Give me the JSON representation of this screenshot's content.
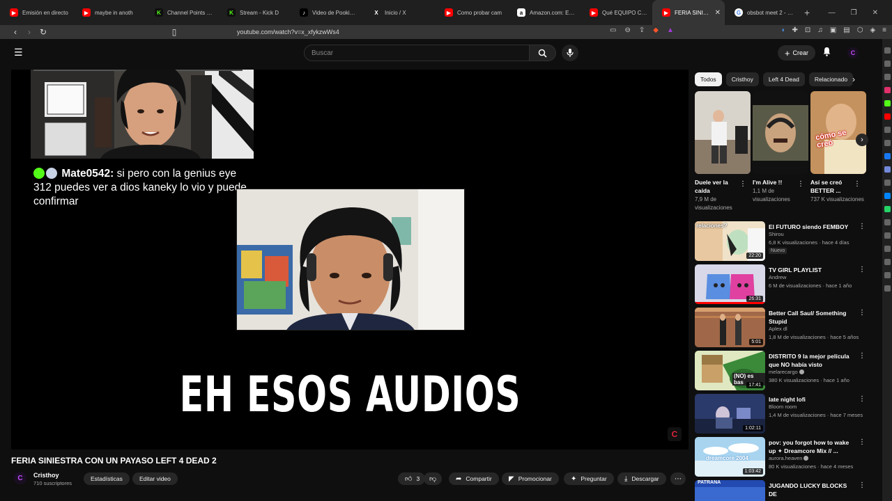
{
  "browser": {
    "tabs": [
      {
        "title": "Emisión en directo",
        "icon": "youtube-icon",
        "kind": "yt"
      },
      {
        "title": "maybe in anoth",
        "icon": "youtube-icon",
        "kind": "yt"
      },
      {
        "title": "Channel Points - Ki",
        "icon": "kick-icon",
        "kind": "kick"
      },
      {
        "title": "Stream - Kick D",
        "icon": "kick-icon",
        "kind": "kick"
      },
      {
        "title": "Video de Pookie be",
        "icon": "tiktok-icon",
        "kind": "tt"
      },
      {
        "title": "Inicio / X",
        "icon": "x-icon",
        "kind": "xx"
      },
      {
        "title": "Como probar cam",
        "icon": "youtube-icon",
        "kind": "yt"
      },
      {
        "title": "Amazon.com: EMB",
        "icon": "amazon-icon",
        "kind": "amz"
      },
      {
        "title": "Qué EQUIPO COMI",
        "icon": "youtube-icon",
        "kind": "yt"
      },
      {
        "title": "FERIA SINIESTR",
        "icon": "youtube-icon",
        "kind": "yt",
        "active": true
      },
      {
        "title": "obsbot meet 2 - Bu",
        "icon": "google-icon",
        "kind": "g"
      }
    ],
    "url": "youtube.com/watch?v=x_xfykzwWs4"
  },
  "header": {
    "search_placeholder": "Buscar",
    "create_label": "Crear",
    "avatar_letter": "C"
  },
  "player": {
    "chat": {
      "user": "Mate0542:",
      "message": "si pero con la genius eye 312 puedes ver a dios kaneky lo vio y puede confirmar"
    },
    "caption": "EH ESOS AUDIOS",
    "watermark_letter": "C"
  },
  "video": {
    "title": "FERIA SINIESTRA CON UN PAYASO LEFT 4 DEAD 2",
    "channel": "Cristhoy",
    "subscribers": "710 suscriptores",
    "avatar_letter": "C",
    "buttons": {
      "stats": "Estadísticas",
      "edit": "Editar video",
      "likes": "3",
      "share": "Compartir",
      "promote": "Promocionar",
      "ask": "Preguntar",
      "download": "Descargar"
    }
  },
  "sidebar": {
    "chips": [
      "Todos",
      "Cristhoy",
      "Left 4 Dead",
      "Relacionado"
    ],
    "shorts": [
      {
        "title": "Duele ver la caída",
        "views": "7,9 M de visualizaciones"
      },
      {
        "title": "I'm Alive !!",
        "views": "1,1 M de visualizaciones"
      },
      {
        "title": "Así se creó BETTER ...",
        "views": "737 K visualizaciones"
      }
    ],
    "short_overlay_text": "cómo se creó",
    "recs": [
      {
        "title": "El FUTURO siendo FEMBOY",
        "channel": "Shirou",
        "meta": "6,8 K visualizaciones · hace 4 días",
        "duration": "22:20",
        "badge": "Nuevo",
        "thumb_text": "relaciones?",
        "verified": false
      },
      {
        "title": "TV GIRL PLAYLIST",
        "channel": "Andrew",
        "meta": "6 M de visualizaciones · hace 1 año",
        "duration": "26:31",
        "progress": 1.0,
        "verified": false
      },
      {
        "title": "Better Call Saul/ Something Stupid",
        "channel": "Aplex dl",
        "meta": "1,8 M de visualizaciones · hace 5 años",
        "duration": "5:01",
        "verified": false
      },
      {
        "title": "DISTRITO 9 la mejor película que NO había visto",
        "channel": "melarecargo",
        "meta": "380 K visualizaciones · hace 1 año",
        "duration": "17:41",
        "thumb_text": "(NO) es bas",
        "verified": true
      },
      {
        "title": "late night lofi",
        "channel": "Bloom room",
        "meta": "1,4 M de visualizaciones · hace 7 meses",
        "duration": "1:02:11",
        "verified": false
      },
      {
        "title": "pov: you forgot how to wake up ✦ Dreamcore Mix // ...",
        "channel": "aurora.heaven",
        "meta": "80 K visualizaciones · hace 4 meses",
        "duration": "1:03:42",
        "thumb_text": "dreamcore 2004",
        "verified": true
      },
      {
        "title": "JUGANDO LUCKY BLOCKS DE",
        "channel": "",
        "meta": "",
        "duration": "",
        "thumb_text": "PATRANA",
        "verified": false
      }
    ]
  }
}
